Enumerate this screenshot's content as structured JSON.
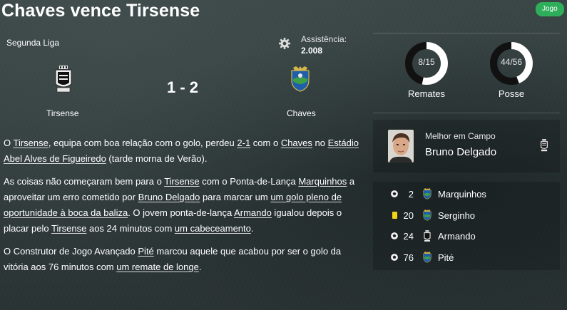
{
  "header": {
    "title": "Chaves vence Tirsense",
    "tag": "Jogo"
  },
  "match": {
    "competition": "Segunda Liga",
    "attendance_label": "Assistência:",
    "attendance_value": "2.008",
    "score": "1 - 2",
    "home_team": "Tirsense",
    "away_team": "Chaves"
  },
  "article": {
    "paragraphs": [
      [
        {
          "t": "O "
        },
        {
          "t": "Tirsense",
          "link": true
        },
        {
          "t": ", equipa com boa relação com o golo, perdeu "
        },
        {
          "t": "2-1",
          "link": true
        },
        {
          "t": " com o "
        },
        {
          "t": "Chaves",
          "link": true
        },
        {
          "t": " no "
        },
        {
          "t": "Estádio Abel Alves de Figueiredo",
          "link": true
        },
        {
          "t": " (tarde morna de Verão)."
        }
      ],
      [
        {
          "t": "As coisas não começaram bem para o "
        },
        {
          "t": "Tirsense",
          "link": true
        },
        {
          "t": " com o Ponta-de-Lança "
        },
        {
          "t": "Marquinhos",
          "link": true
        },
        {
          "t": " a aproveitar um erro cometido por "
        },
        {
          "t": "Bruno Delgado",
          "link": true
        },
        {
          "t": " para marcar um "
        },
        {
          "t": "um golo pleno de oportunidade à boca da baliza",
          "link": true
        },
        {
          "t": ". O jovem ponta-de-lança "
        },
        {
          "t": "Armando",
          "link": true
        },
        {
          "t": " igualou depois o placar pelo "
        },
        {
          "t": "Tirsense",
          "link": true
        },
        {
          "t": " aos 24 minutos com "
        },
        {
          "t": "um cabeceamento",
          "link": true
        },
        {
          "t": "."
        }
      ],
      [
        {
          "t": "O Construtor de Jogo Avançado "
        },
        {
          "t": "Pité",
          "link": true
        },
        {
          "t": " marcou aquele que acabou por ser o golo da vitória aos 76 minutos com "
        },
        {
          "t": "um remate de longe",
          "link": true
        },
        {
          "t": "."
        }
      ]
    ]
  },
  "stats": {
    "shots": {
      "value_text": "8/15",
      "label": "Remates",
      "fraction": 0.533
    },
    "possession": {
      "value_text": "44/56",
      "label": "Posse",
      "fraction": 0.44
    }
  },
  "man_of_match": {
    "title": "Melhor em Campo",
    "name": "Bruno Delgado"
  },
  "events": [
    {
      "type": "goal",
      "icon": "ball-icon",
      "minute": "2",
      "club": "chaves",
      "player": "Marquinhos"
    },
    {
      "type": "yellow",
      "icon": "yellow-card-icon",
      "minute": "20",
      "club": "chaves",
      "player": "Serginho"
    },
    {
      "type": "goal",
      "icon": "ball-icon",
      "minute": "24",
      "club": "tirsense",
      "player": "Armando"
    },
    {
      "type": "goal",
      "icon": "ball-icon",
      "minute": "76",
      "club": "chaves",
      "player": "Pité"
    }
  ],
  "colors": {
    "tag_green": "#2eae5a",
    "donut_white": "#ffffff",
    "donut_dark": "#111111",
    "yellow_card": "#f2d21b"
  }
}
